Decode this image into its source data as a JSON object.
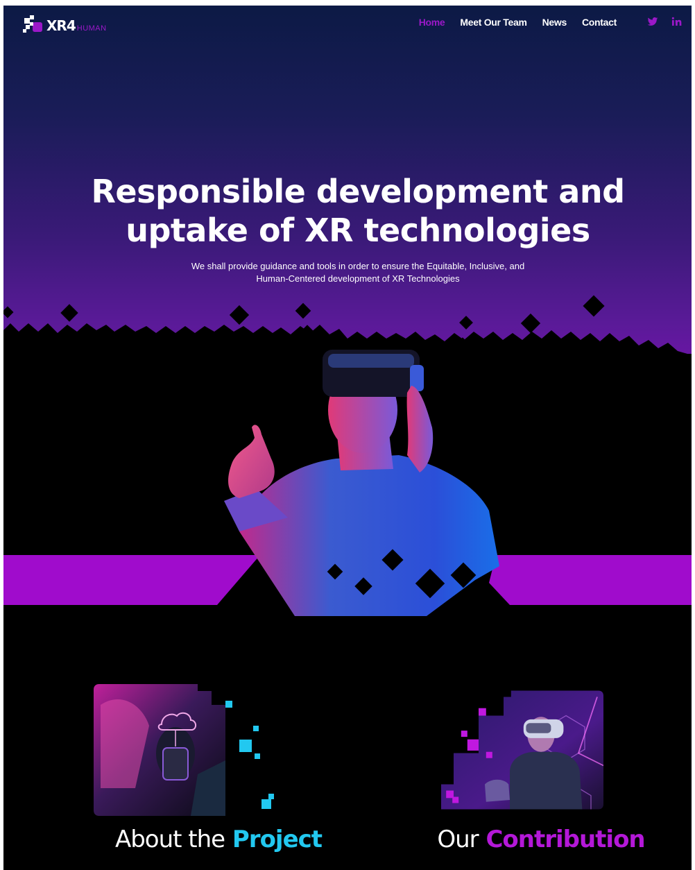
{
  "brand": {
    "logo_text": "XR4",
    "logo_sub": "HUMAN"
  },
  "nav": {
    "items": [
      {
        "label": "Home",
        "active": true
      },
      {
        "label": "Meet Our Team",
        "active": false
      },
      {
        "label": "News",
        "active": false
      },
      {
        "label": "Contact",
        "active": false
      }
    ],
    "social": [
      "twitter-icon",
      "linkedin-icon"
    ]
  },
  "hero": {
    "title_line1": "Responsible development and",
    "title_line2": "uptake of XR technologies",
    "subtitle_line1": "We shall provide guidance and tools in order to ensure the Equitable, Inclusive, and",
    "subtitle_line2": "Human-Centered development of XR Technologies"
  },
  "features": [
    {
      "title_light": "About the",
      "title_accent": "Project",
      "accent_color": "#22c8f0"
    },
    {
      "title_light": "Our",
      "title_accent": "Contribution",
      "accent_color": "#b418d8"
    }
  ],
  "colors": {
    "accent_purple": "#9b18c8",
    "band_purple": "#a00ccc",
    "accent_cyan": "#22c8f0",
    "background": "#000000"
  }
}
